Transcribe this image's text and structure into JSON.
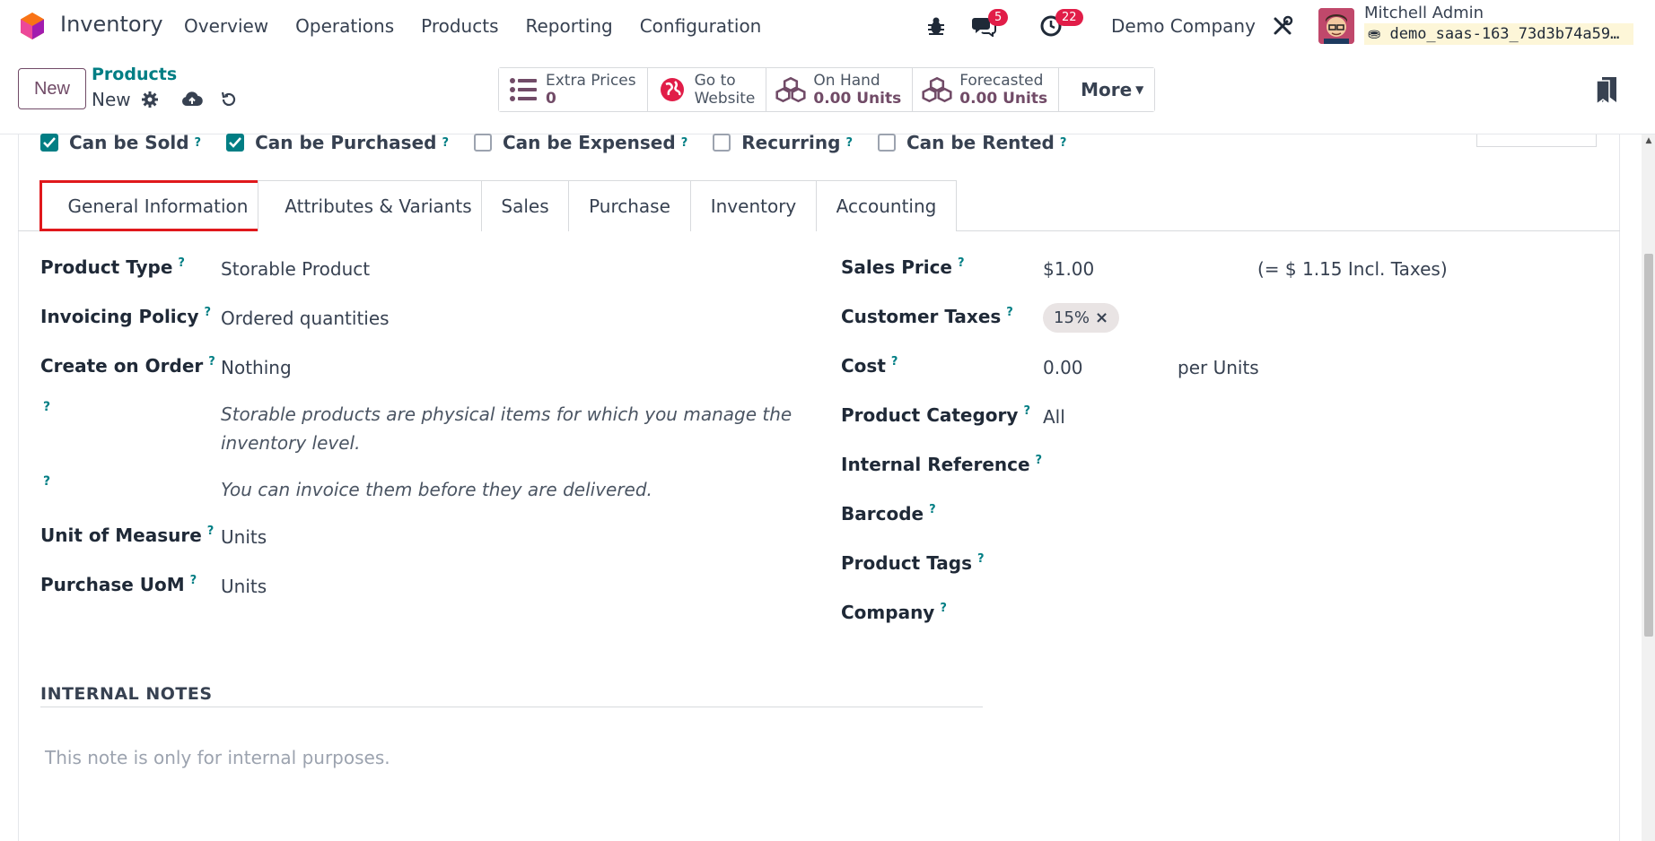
{
  "navbar": {
    "app_name": "Inventory",
    "menu": [
      "Overview",
      "Operations",
      "Products",
      "Reporting",
      "Configuration"
    ],
    "messages_count": "5",
    "activities_count": "22",
    "company": "Demo Company",
    "user_name": "Mitchell Admin",
    "database": "demo_saas-163_73d3b74a59…"
  },
  "control": {
    "new_label": "New",
    "breadcrumb_parent": "Products",
    "breadcrumb_current": "New",
    "smart_buttons": [
      {
        "label": "Extra Prices",
        "value": "0",
        "icon": "list-icon"
      },
      {
        "label": "Go to",
        "value": "Website",
        "icon": "globe-icon"
      },
      {
        "label": "On Hand",
        "value": "0.00 Units",
        "icon": "cubes-icon"
      },
      {
        "label": "Forecasted",
        "value": "0.00 Units",
        "icon": "cubes-icon"
      }
    ],
    "more_label": "More"
  },
  "checkboxes": [
    {
      "label": "Can be Sold",
      "checked": true
    },
    {
      "label": "Can be Purchased",
      "checked": true
    },
    {
      "label": "Can be Expensed",
      "checked": false
    },
    {
      "label": "Recurring",
      "checked": false
    },
    {
      "label": "Can be Rented",
      "checked": false
    }
  ],
  "tabs": [
    "General Information",
    "Attributes & Variants",
    "Sales",
    "Purchase",
    "Inventory",
    "Accounting"
  ],
  "left_fields": {
    "product_type_label": "Product Type",
    "product_type_value": "Storable Product",
    "invoicing_policy_label": "Invoicing Policy",
    "invoicing_policy_value": "Ordered quantities",
    "create_on_order_label": "Create on Order",
    "create_on_order_value": "Nothing",
    "product_type_help": "Storable products are physical items for which you manage the inventory level.",
    "invoicing_help": "You can invoice them before they are delivered.",
    "uom_label": "Unit of Measure",
    "uom_value": "Units",
    "purchase_uom_label": "Purchase UoM",
    "purchase_uom_value": "Units"
  },
  "right_fields": {
    "sales_price_label": "Sales Price",
    "sales_price_value": "$1.00",
    "incl_taxes": "(= $ 1.15 Incl. Taxes)",
    "customer_taxes_label": "Customer Taxes",
    "tax_tag": "15%",
    "cost_label": "Cost",
    "cost_value": "0.00",
    "cost_unit": "per Units",
    "category_label": "Product Category",
    "category_value": "All",
    "internal_ref_label": "Internal Reference",
    "barcode_label": "Barcode",
    "tags_label": "Product Tags",
    "company_label": "Company"
  },
  "notes": {
    "title": "INTERNAL NOTES",
    "placeholder": "This note is only for internal purposes."
  },
  "help_mark": "?"
}
